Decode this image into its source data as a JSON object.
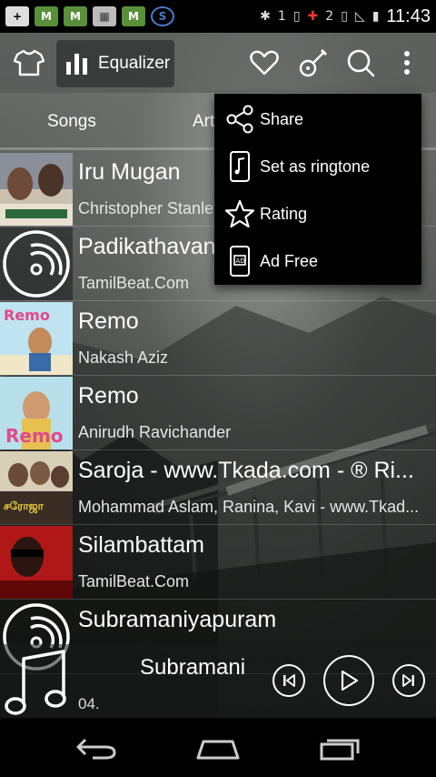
{
  "status_bar": {
    "time": "11:43",
    "sim1": "1",
    "sim2": "2",
    "notification_icons": [
      "plus-icon",
      "market-icon",
      "market-icon",
      "window-icon",
      "market-icon",
      "s-icon"
    ]
  },
  "toolbar": {
    "equalizer_label": "Equalizer"
  },
  "tabs": [
    {
      "label": "Songs"
    },
    {
      "label": "Art"
    }
  ],
  "menu": {
    "items": [
      {
        "label": "Share",
        "icon": "share-icon"
      },
      {
        "label": "Set as ringtone",
        "icon": "ringtone-icon"
      },
      {
        "label": "Rating",
        "icon": "star-icon"
      },
      {
        "label": "Ad Free",
        "icon": "ad-free-icon"
      }
    ]
  },
  "songs": [
    {
      "title": "Iru Mugan",
      "artist": "Christopher Stanley",
      "thumb": "iru-mugan-cover"
    },
    {
      "title": "Padikathavan",
      "artist": "TamilBeat.Com",
      "thumb": "music-disc-icon"
    },
    {
      "title": "Remo",
      "artist": "Nakash Aziz",
      "thumb": "remo-cover"
    },
    {
      "title": "Remo",
      "artist": "Anirudh Ravichander",
      "thumb": "remo-cover-2"
    },
    {
      "title": "Saroja - www.Tkada.com - ® Ri...",
      "artist": "Mohammad Aslam, Ranina, Kavi - www.Tkad...",
      "thumb": "saroja-cover"
    },
    {
      "title": "Silambattam",
      "artist": "TamilBeat.Com",
      "thumb": "silambattam-cover"
    },
    {
      "title": "Subramaniyapuram",
      "artist": "",
      "thumb": "music-disc-icon"
    }
  ],
  "mini_player": {
    "title": "Subramani",
    "subtitle": "04."
  },
  "colors": {
    "menu_bg": "#000000",
    "text": "#ffffff"
  }
}
